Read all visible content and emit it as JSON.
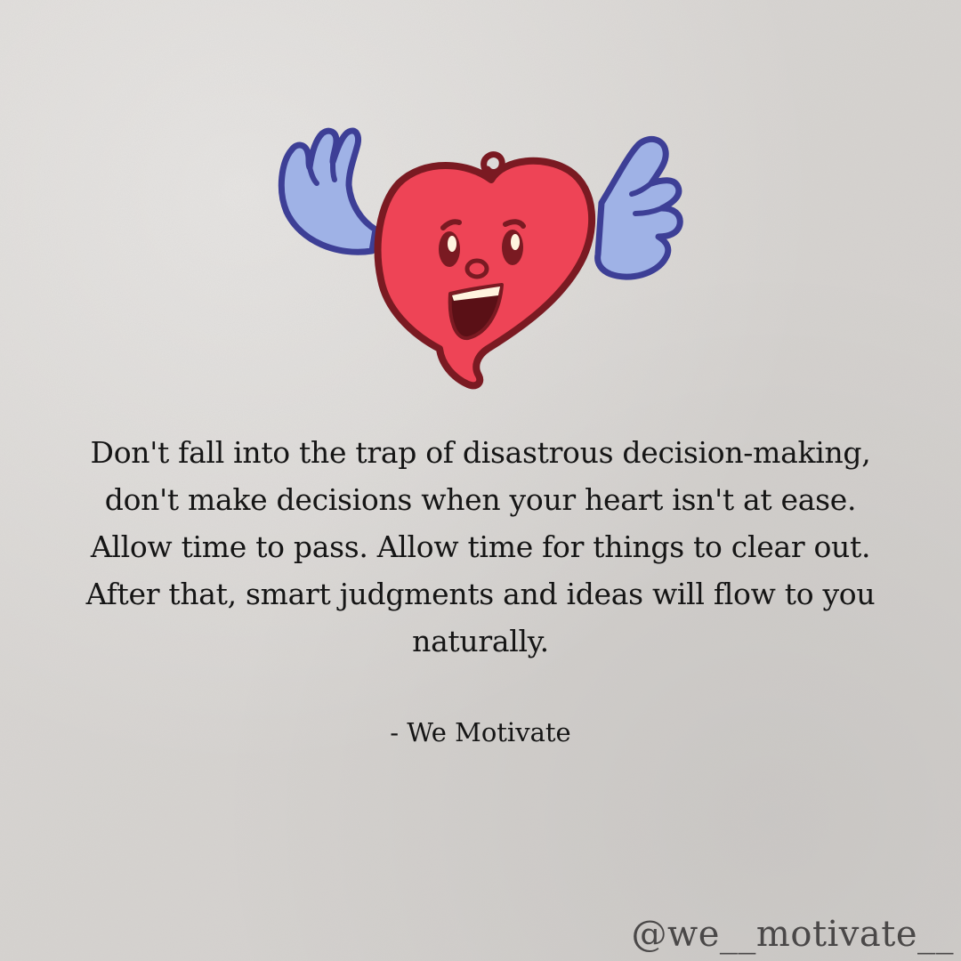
{
  "illustration": {
    "icon": "winged-heart-icon",
    "colors": {
      "heart_fill": "#ee4456",
      "heart_outline": "#7a1a22",
      "wing_fill": "#9fb2e6",
      "wing_outline": "#3d3f96"
    }
  },
  "quote": {
    "text": "Don't fall into the trap of disastrous decision-making, don't make decisions when your heart isn't at ease. Allow time to pass. Allow time for things to clear out. After that, smart judgments and ideas will flow to you naturally."
  },
  "author": {
    "text": "- We Motivate"
  },
  "watermark": {
    "handle": "@we__motivate__"
  }
}
